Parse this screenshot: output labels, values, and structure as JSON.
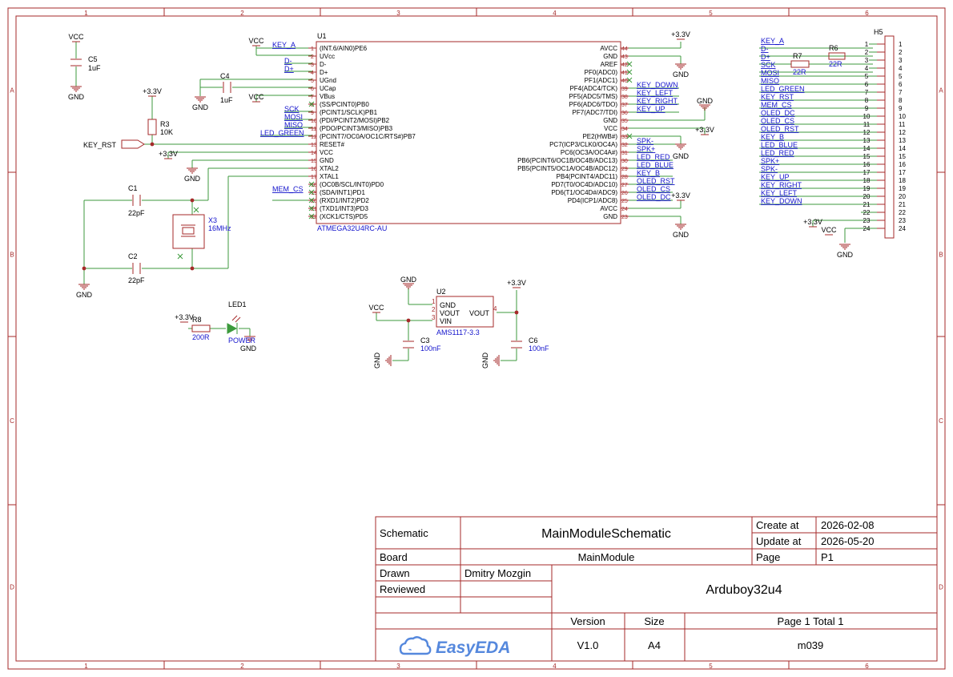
{
  "colors": {
    "frame": "#a52a2a",
    "wire": "#3c9a3c",
    "part": "#a52a2a",
    "netlabel": "#1414cc",
    "text": "#000000",
    "pin": "#a52a2a",
    "noconnect": "#3c9a3c",
    "logo": "#5588dd"
  },
  "frame": {
    "cols": [
      "1",
      "2",
      "3",
      "4",
      "5",
      "6"
    ],
    "rows": [
      "A",
      "B",
      "C",
      "D"
    ]
  },
  "title_block": {
    "schematic_label": "Schematic",
    "schematic_value": "MainModuleSchematic",
    "board_label": "Board",
    "board_value": "MainModule",
    "drawn_label": "Drawn",
    "drawn_value": "Dmitry Mozgin",
    "reviewed_label": "Reviewed",
    "create_label": "Create at",
    "create_value": "2026-02-08",
    "update_label": "Update at",
    "update_value": "2026-05-20",
    "page_label": "Page",
    "page_value": "P1",
    "project": "Arduboy32u4",
    "version_label": "Version",
    "version_value": "V1.0",
    "size_label": "Size",
    "size_value": "A4",
    "pages": "Page  1  Total  1",
    "code": "m039",
    "logo_text": "EasyEDA"
  },
  "power": {
    "vcc": "VCC",
    "gnd": "GND",
    "v33": "+3.3V"
  },
  "parts": {
    "c5": {
      "ref": "C5",
      "val": "1uF"
    },
    "c4": {
      "ref": "C4",
      "val": "1uF"
    },
    "r3": {
      "ref": "R3",
      "val": "10K"
    },
    "c1": {
      "ref": "C1",
      "val": "22pF"
    },
    "c2": {
      "ref": "C2",
      "val": "22pF"
    },
    "x3": {
      "ref": "X3",
      "val": "16MHz"
    },
    "led1": {
      "ref": "LED1",
      "val": "POWER"
    },
    "r8": {
      "ref": "R8",
      "val": "200R"
    },
    "u2": {
      "ref": "U2",
      "val": "AMS1117-3.3",
      "pins": [
        "GND",
        "VOUT",
        "VIN",
        "VOUT"
      ]
    },
    "c3": {
      "ref": "C3",
      "val": "100nF"
    },
    "c6": {
      "ref": "C6",
      "val": "100nF"
    },
    "r7": {
      "ref": "R7",
      "val": "22R"
    },
    "r6": {
      "ref": "R6",
      "val": "22R"
    },
    "h5": {
      "ref": "H5"
    },
    "u1": {
      "ref": "U1",
      "val": "ATMEGA32U4RC-AU"
    }
  },
  "u1_left": [
    {
      "num": "1",
      "name": "(INT.6/AIN0)PE6",
      "net": "KEY_A"
    },
    {
      "num": "2",
      "name": "UVcc",
      "net": ""
    },
    {
      "num": "3",
      "name": "D-",
      "net": "D-"
    },
    {
      "num": "4",
      "name": "D+",
      "net": "D+"
    },
    {
      "num": "5",
      "name": "UGnd",
      "net": ""
    },
    {
      "num": "6",
      "name": "UCap",
      "net": ""
    },
    {
      "num": "7",
      "name": "VBus",
      "net": ""
    },
    {
      "num": "8",
      "name": "(SS/PCINT0)PB0",
      "net": ""
    },
    {
      "num": "9",
      "name": "(PCINT1/SCLK)PB1",
      "net": "SCK"
    },
    {
      "num": "10",
      "name": "(PDI/PCINT2/MOSI)PB2",
      "net": "MOSI"
    },
    {
      "num": "11",
      "name": "(PDO/PCINT3/MISO)PB3",
      "net": "MISO"
    },
    {
      "num": "12",
      "name": "(PCINT7/OC0A/OC1C/RTS#)PB7",
      "net": "LED_GREEN"
    },
    {
      "num": "13",
      "name": "RESET#",
      "net": ""
    },
    {
      "num": "14",
      "name": "VCC",
      "net": ""
    },
    {
      "num": "15",
      "name": "GND",
      "net": ""
    },
    {
      "num": "16",
      "name": "XTAL2",
      "net": ""
    },
    {
      "num": "17",
      "name": "XTAL1",
      "net": ""
    },
    {
      "num": "18",
      "name": "(OC0B/SCL/INT0)PD0",
      "net": ""
    },
    {
      "num": "19",
      "name": "(SDA/INT1)PD1",
      "net": "MEM_CS"
    },
    {
      "num": "20",
      "name": "(RXD1/INT2)PD2",
      "net": ""
    },
    {
      "num": "21",
      "name": "(TXD1/INT3)PD3",
      "net": ""
    },
    {
      "num": "22",
      "name": "(XCK1/CTS)PD5",
      "net": ""
    }
  ],
  "u1_right": [
    {
      "num": "44",
      "name": "AVCC",
      "net": ""
    },
    {
      "num": "43",
      "name": "GND",
      "net": ""
    },
    {
      "num": "42",
      "name": "AREF",
      "net": ""
    },
    {
      "num": "41",
      "name": "PF0(ADC0)",
      "net": ""
    },
    {
      "num": "40",
      "name": "PF1(ADC1)",
      "net": ""
    },
    {
      "num": "39",
      "name": "PF4(ADC4/TCK)",
      "net": "KEY_DOWN"
    },
    {
      "num": "38",
      "name": "PF5(ADC5/TMS)",
      "net": "KEY_LEFT"
    },
    {
      "num": "37",
      "name": "PF6(ADC6/TDO)",
      "net": "KEY_RIGHT"
    },
    {
      "num": "36",
      "name": "PF7(ADC7/TDI)",
      "net": "KEY_UP"
    },
    {
      "num": "35",
      "name": "GND",
      "net": ""
    },
    {
      "num": "34",
      "name": "VCC",
      "net": ""
    },
    {
      "num": "33",
      "name": "PE2(HWB#)",
      "net": ""
    },
    {
      "num": "32",
      "name": "PC7(ICP3/CLK0/OC4A)",
      "net": "SPK-"
    },
    {
      "num": "31",
      "name": "PC6(OC3A/OC4A#)",
      "net": "SPK+"
    },
    {
      "num": "30",
      "name": "PB6(PCINT6/OC1B/OC4B/ADC13)",
      "net": "LED_RED"
    },
    {
      "num": "29",
      "name": "PB5(PCINT5/OC1A/OC4B/ADC12)",
      "net": "LED_BLUE"
    },
    {
      "num": "28",
      "name": "PB4(PCINT4/ADC11)",
      "net": "KEY_B"
    },
    {
      "num": "27",
      "name": "PD7(T0/OC4D/ADC10)",
      "net": "OLED_RST"
    },
    {
      "num": "26",
      "name": "PD6(T1/OC4D#/ADC9)",
      "net": "OLED_CS"
    },
    {
      "num": "25",
      "name": "PD4(ICP1/ADC8)",
      "net": "OLED_DC"
    },
    {
      "num": "24",
      "name": "AVCC",
      "net": ""
    },
    {
      "num": "23",
      "name": "GND",
      "net": ""
    }
  ],
  "h5_nets": [
    "KEY_A",
    "D-",
    "D+",
    "SCK",
    "MOSI",
    "MISO",
    "LED_GREEN",
    "KEY_RST",
    "MEM_CS",
    "OLED_DC",
    "OLED_CS",
    "OLED_RST",
    "KEY_B",
    "LED_BLUE",
    "LED_RED",
    "SPK+",
    "SPK-",
    "KEY_UP",
    "KEY_RIGHT",
    "KEY_LEFT",
    "KEY_DOWN",
    "",
    "+3.3V",
    "VCC"
  ],
  "h5_pins": [
    "1",
    "2",
    "3",
    "4",
    "5",
    "6",
    "7",
    "8",
    "9",
    "10",
    "11",
    "12",
    "13",
    "14",
    "15",
    "16",
    "17",
    "18",
    "19",
    "20",
    "21",
    "22",
    "23",
    "24"
  ],
  "misc": {
    "key_rst": "KEY_RST"
  }
}
